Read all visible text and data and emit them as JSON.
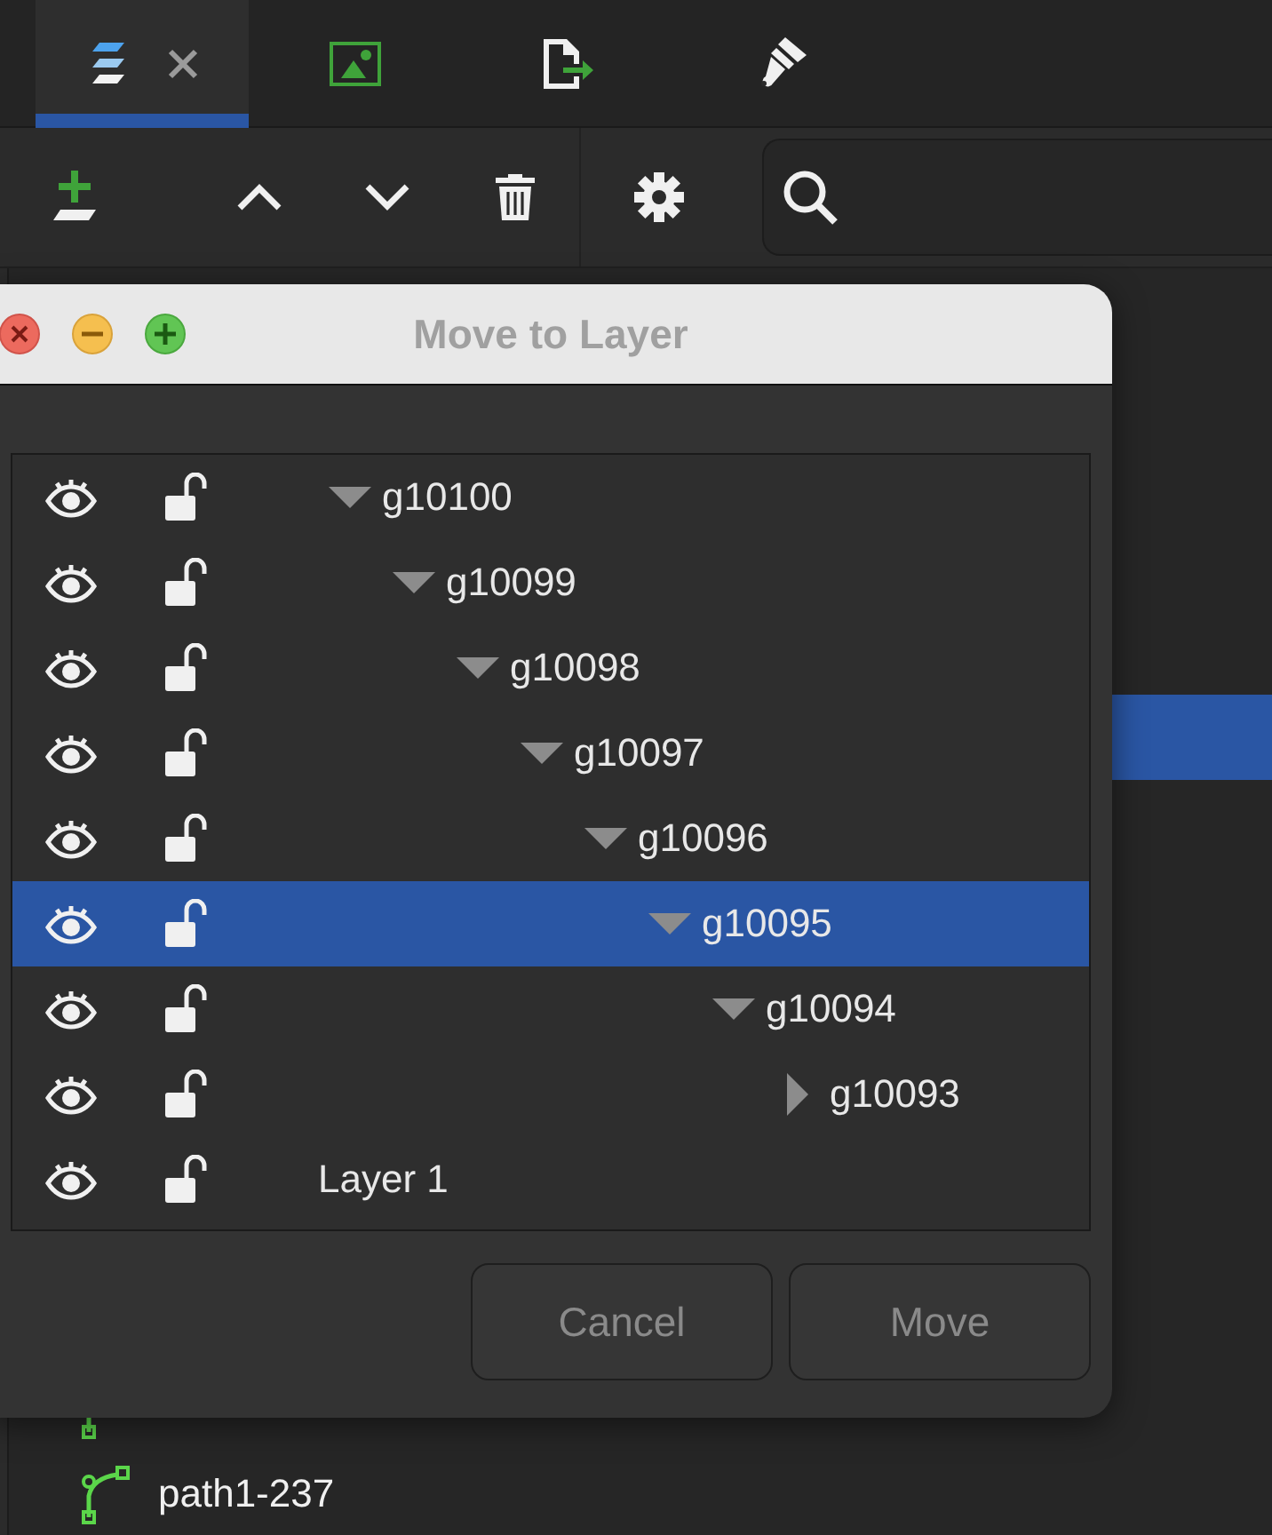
{
  "tabs": [
    {
      "kind": "layers",
      "selected": true,
      "closable": true
    },
    {
      "kind": "image",
      "selected": false
    },
    {
      "kind": "export",
      "selected": false
    },
    {
      "kind": "brush",
      "selected": false
    }
  ],
  "background_list": {
    "highlight_visible": true,
    "items": [
      {
        "kind": "path"
      },
      {
        "kind": "path",
        "label": "path1-237"
      }
    ]
  },
  "dialog": {
    "title": "Move to Layer",
    "layers": [
      {
        "label": "g10100",
        "visible": true,
        "locked": false,
        "expanded": true,
        "selected": false,
        "children": [
          {
            "label": "g10099",
            "visible": true,
            "locked": false,
            "expanded": true,
            "selected": false,
            "children": [
              {
                "label": "g10098",
                "visible": true,
                "locked": false,
                "expanded": true,
                "selected": false,
                "children": [
                  {
                    "label": "g10097",
                    "visible": true,
                    "locked": false,
                    "expanded": true,
                    "selected": false,
                    "children": [
                      {
                        "label": "g10096",
                        "visible": true,
                        "locked": false,
                        "expanded": true,
                        "selected": false,
                        "children": [
                          {
                            "label": "g10095",
                            "visible": true,
                            "locked": false,
                            "expanded": true,
                            "selected": true,
                            "children": [
                              {
                                "label": "g10094",
                                "visible": true,
                                "locked": false,
                                "expanded": true,
                                "selected": false,
                                "children": [
                                  {
                                    "label": "g10093",
                                    "visible": true,
                                    "locked": false,
                                    "expanded": false,
                                    "selected": false
                                  }
                                ]
                              }
                            ]
                          }
                        ]
                      }
                    ]
                  }
                ]
              }
            ]
          }
        ]
      },
      {
        "label": "Layer 1",
        "visible": true,
        "locked": false,
        "selected": false
      }
    ],
    "buttons": [
      {
        "label": "Cancel",
        "disabled": true
      },
      {
        "label": "Move",
        "disabled": true
      }
    ]
  }
}
